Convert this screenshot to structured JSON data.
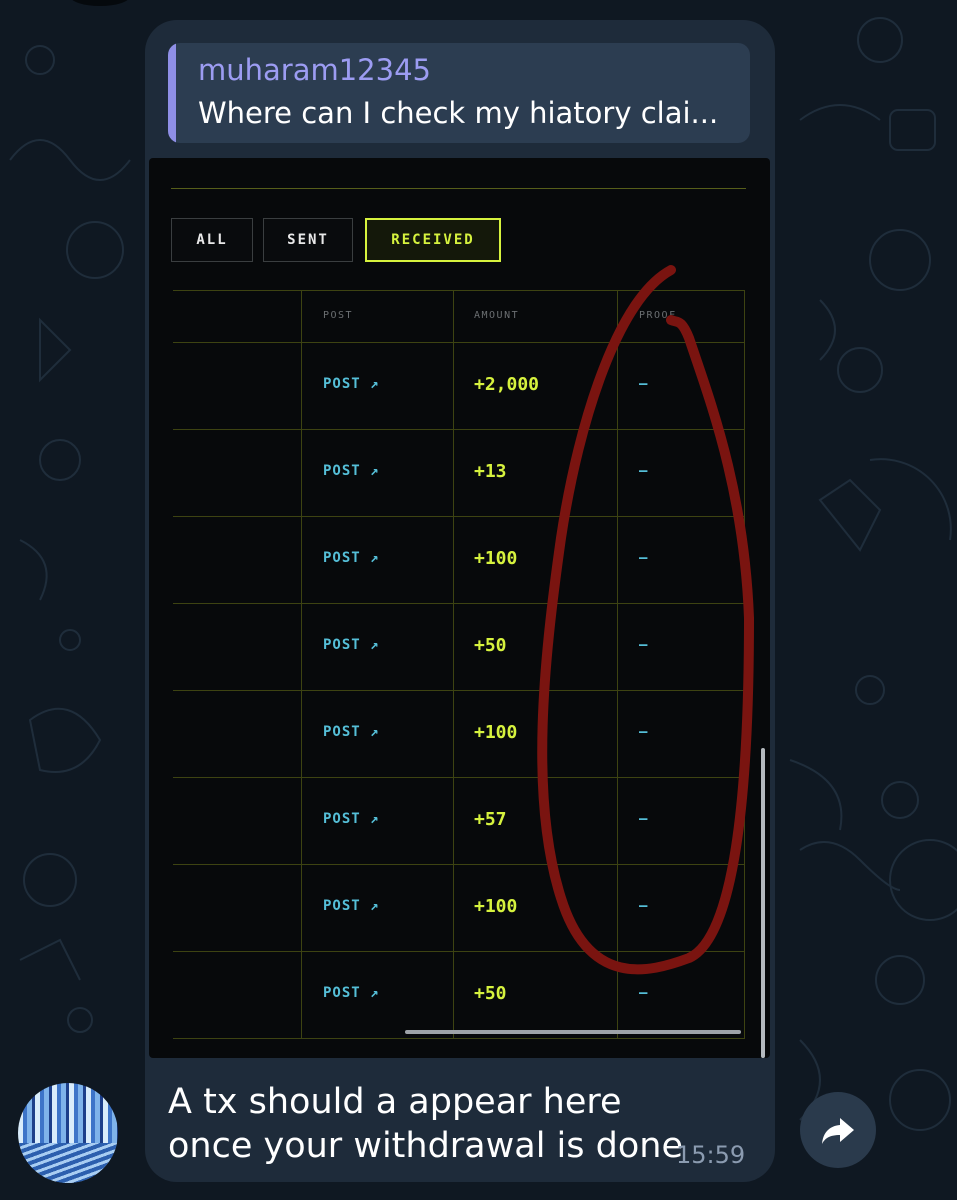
{
  "reply": {
    "author": "muharam12345",
    "text": "Where can I check my hiatory clai..."
  },
  "screenshot": {
    "tabs": [
      {
        "label": "ALL",
        "active": false
      },
      {
        "label": "SENT",
        "active": false
      },
      {
        "label": "RECEIVED",
        "active": true
      }
    ],
    "columns": [
      "POST",
      "AMOUNT",
      "PROOF"
    ],
    "rows": [
      {
        "post": "POST ↗",
        "amount": "+2,000",
        "proof": "–"
      },
      {
        "post": "POST ↗",
        "amount": "+13",
        "proof": "–"
      },
      {
        "post": "POST ↗",
        "amount": "+100",
        "proof": "–"
      },
      {
        "post": "POST ↗",
        "amount": "+50",
        "proof": "–"
      },
      {
        "post": "POST ↗",
        "amount": "+100",
        "proof": "–"
      },
      {
        "post": "POST ↗",
        "amount": "+57",
        "proof": "–"
      },
      {
        "post": "POST ↗",
        "amount": "+100",
        "proof": "–"
      },
      {
        "post": "POST ↗",
        "amount": "+50",
        "proof": "–"
      }
    ],
    "colors": {
      "accent": "#d6f23e",
      "link": "#55bfd8",
      "annotation": "#7a1410"
    }
  },
  "message": {
    "text": "A tx should a appear here once your withdrawal is done",
    "time": "15:59"
  },
  "icons": {
    "forward": "forward-arrow-icon",
    "avatar": "avatar"
  },
  "colors": {
    "background": "#0f1822",
    "bubble": "#1e2b3a",
    "reply_box": "#2c3d51",
    "reply_accent": "#8f8fe6"
  }
}
